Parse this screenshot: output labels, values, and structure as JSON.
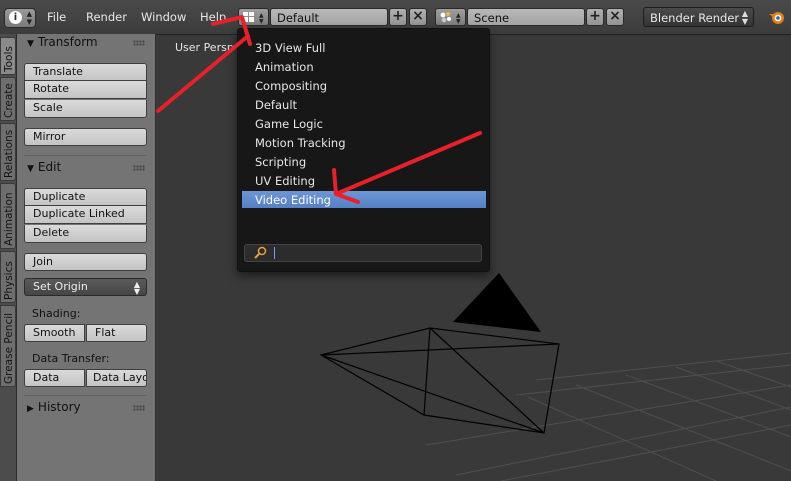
{
  "topbar": {
    "menus": [
      "File",
      "Render",
      "Window",
      "Help"
    ],
    "screen_layout": "Default",
    "scene": "Scene",
    "render_engine": "Blender Render"
  },
  "tabs": [
    "Tools",
    "Create",
    "Relations",
    "Animation",
    "Physics",
    "Grease Pencil"
  ],
  "shelf": {
    "transform": {
      "title": "Transform",
      "buttons": [
        "Translate",
        "Rotate",
        "Scale",
        "Mirror"
      ]
    },
    "edit": {
      "title": "Edit",
      "buttons": [
        "Duplicate",
        "Duplicate Linked",
        "Delete",
        "Join"
      ],
      "set_origin": "Set Origin",
      "shading_label": "Shading:",
      "shading_buttons": [
        "Smooth",
        "Flat"
      ],
      "data_transfer_label": "Data Transfer:",
      "data_transfer_buttons": [
        "Data",
        "Data Layo"
      ]
    },
    "history": {
      "title": "History"
    }
  },
  "viewport": {
    "label": "User Persp"
  },
  "dropdown": {
    "items": [
      "3D View Full",
      "Animation",
      "Compositing",
      "Default",
      "Game Logic",
      "Motion Tracking",
      "Scripting",
      "UV Editing",
      "Video Editing"
    ],
    "selected": "Video Editing",
    "search_value": ""
  },
  "colors": {
    "highlight": "#5a86cc",
    "annotation": "#e8202a",
    "viewport_bg": "#393939"
  }
}
